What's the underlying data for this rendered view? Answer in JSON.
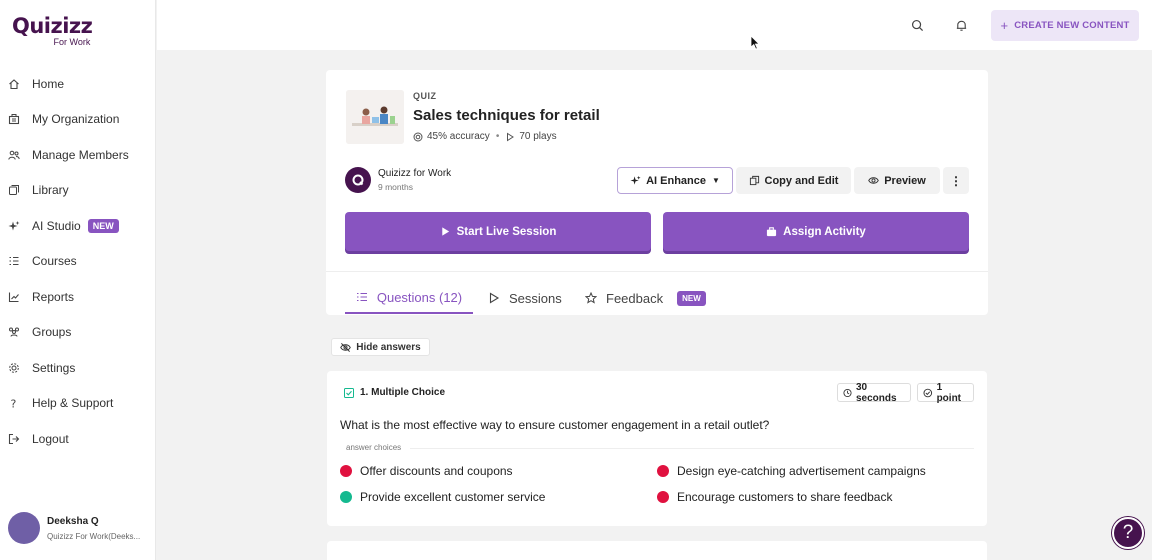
{
  "app": {
    "logo_text": "Quizizz",
    "logo_sub": "For Work"
  },
  "sidebar": {
    "items": [
      {
        "label": "Home",
        "icon": "home-icon"
      },
      {
        "label": "My Organization",
        "icon": "building-icon"
      },
      {
        "label": "Manage Members",
        "icon": "members-icon"
      },
      {
        "label": "Library",
        "icon": "library-icon"
      },
      {
        "label": "AI Studio",
        "icon": "sparkle-icon",
        "badge": "NEW"
      },
      {
        "label": "Courses",
        "icon": "courses-icon"
      },
      {
        "label": "Reports",
        "icon": "chart-icon"
      },
      {
        "label": "Groups",
        "icon": "groups-icon"
      },
      {
        "label": "Settings",
        "icon": "gear-icon"
      },
      {
        "label": "Help & Support",
        "icon": "question-icon"
      },
      {
        "label": "Logout",
        "icon": "logout-icon"
      }
    ],
    "user": {
      "name": "Deeksha Q",
      "org": "Quizizz For Work(Deeks..."
    }
  },
  "header": {
    "create_label": "CREATE NEW CONTENT"
  },
  "quiz": {
    "tag": "QUIZ",
    "title": "Sales techniques for retail",
    "accuracy": "45% accuracy",
    "plays": "70 plays",
    "author": "Quizizz for Work",
    "time_ago": "9 months",
    "ai_enhance": "AI Enhance",
    "copy_edit": "Copy and Edit",
    "preview": "Preview",
    "start_live": "Start Live Session",
    "assign": "Assign Activity"
  },
  "tabs": {
    "questions": "Questions (12)",
    "sessions": "Sessions",
    "feedback": "Feedback",
    "feedback_badge": "NEW"
  },
  "hide_answers": "Hide answers",
  "question": {
    "type": "1. Multiple Choice",
    "time": "30 seconds",
    "points": "1 point",
    "text": "What is the most effective way to ensure customer engagement in a retail outlet?",
    "choices_label": "answer choices",
    "choices": [
      {
        "text": "Offer discounts and coupons",
        "correct": false
      },
      {
        "text": "Design eye-catching advertisement campaigns",
        "correct": false
      },
      {
        "text": "Provide excellent customer service",
        "correct": true
      },
      {
        "text": "Encourage customers to share feedback",
        "correct": false
      }
    ]
  },
  "colors": {
    "brand_purple": "#8854c0",
    "dark_purple": "#46134e",
    "correct": "#14b98f",
    "incorrect": "#e0113f"
  }
}
